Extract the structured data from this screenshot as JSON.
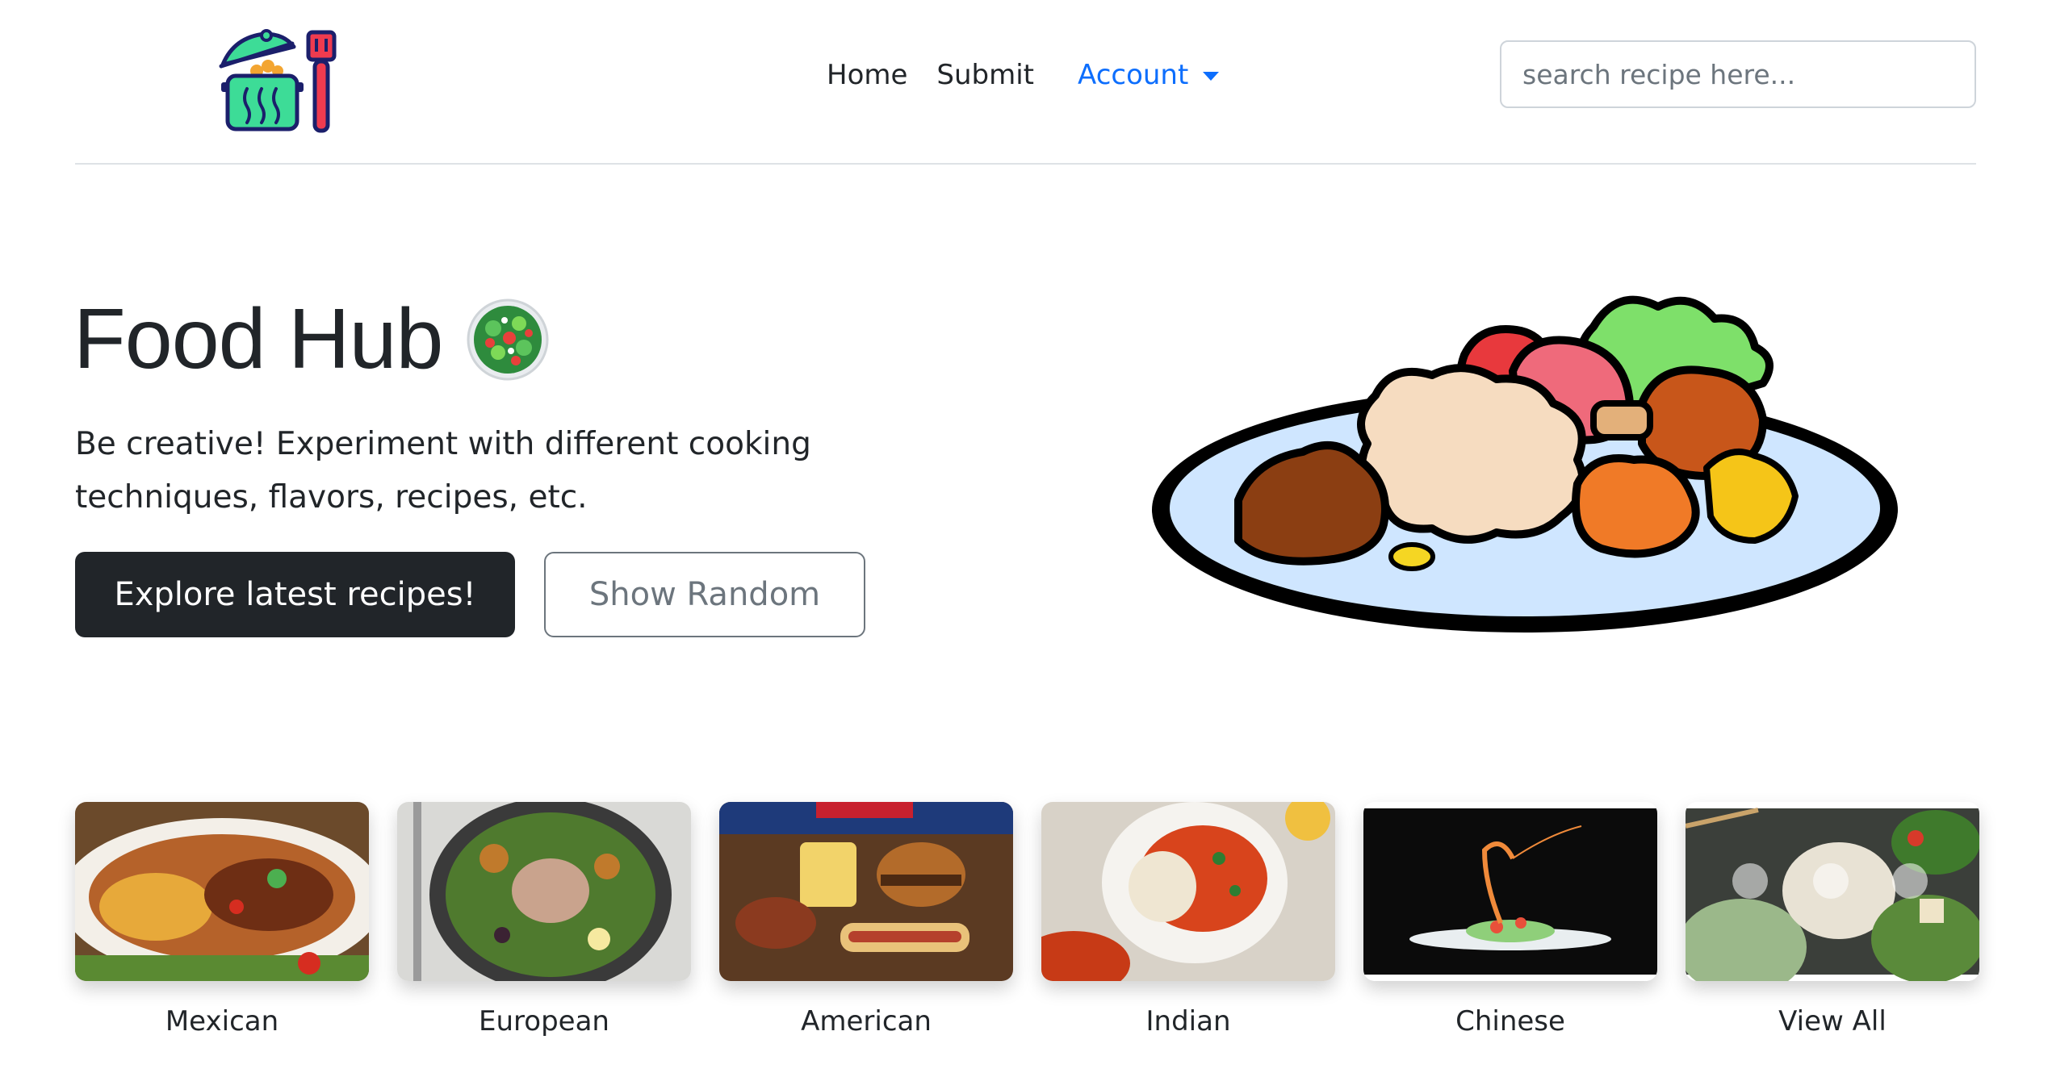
{
  "header": {
    "nav": [
      {
        "label": "Home"
      },
      {
        "label": "Submit"
      }
    ],
    "account_label": "Account",
    "search_placeholder": "search recipe here..."
  },
  "hero": {
    "title": "Food Hub",
    "text": "Be creative! Experiment with different cooking techniques, flavors, recipes, etc.",
    "primary_button": "Explore latest recipes!",
    "secondary_button": "Show Random"
  },
  "categories": [
    {
      "label": "Mexican"
    },
    {
      "label": "European"
    },
    {
      "label": "American"
    },
    {
      "label": "Indian"
    },
    {
      "label": "Chinese"
    },
    {
      "label": "View All"
    }
  ],
  "colors": {
    "accent": "#0d6efd",
    "dark_button": "#212529",
    "outline_button": "#6c757d",
    "divider": "#dee2e6"
  },
  "icons": [
    "cooking-pot-logo",
    "salad-icon",
    "chevron-down-icon",
    "food-plate-illustration"
  ]
}
